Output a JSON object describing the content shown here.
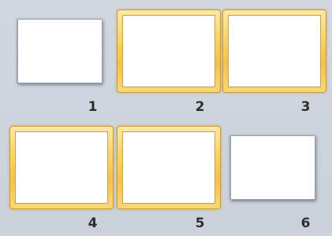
{
  "slide_sorter": {
    "slides": [
      {
        "number": "1",
        "selected": false
      },
      {
        "number": "2",
        "selected": true
      },
      {
        "number": "3",
        "selected": true
      },
      {
        "number": "4",
        "selected": true
      },
      {
        "number": "5",
        "selected": true
      },
      {
        "number": "6",
        "selected": false
      }
    ]
  },
  "colors": {
    "background": "#cdd3dc",
    "selection_gold": "#f4c24a",
    "thumbnail": "#ffffff",
    "number_text": "#2d2d2d"
  }
}
